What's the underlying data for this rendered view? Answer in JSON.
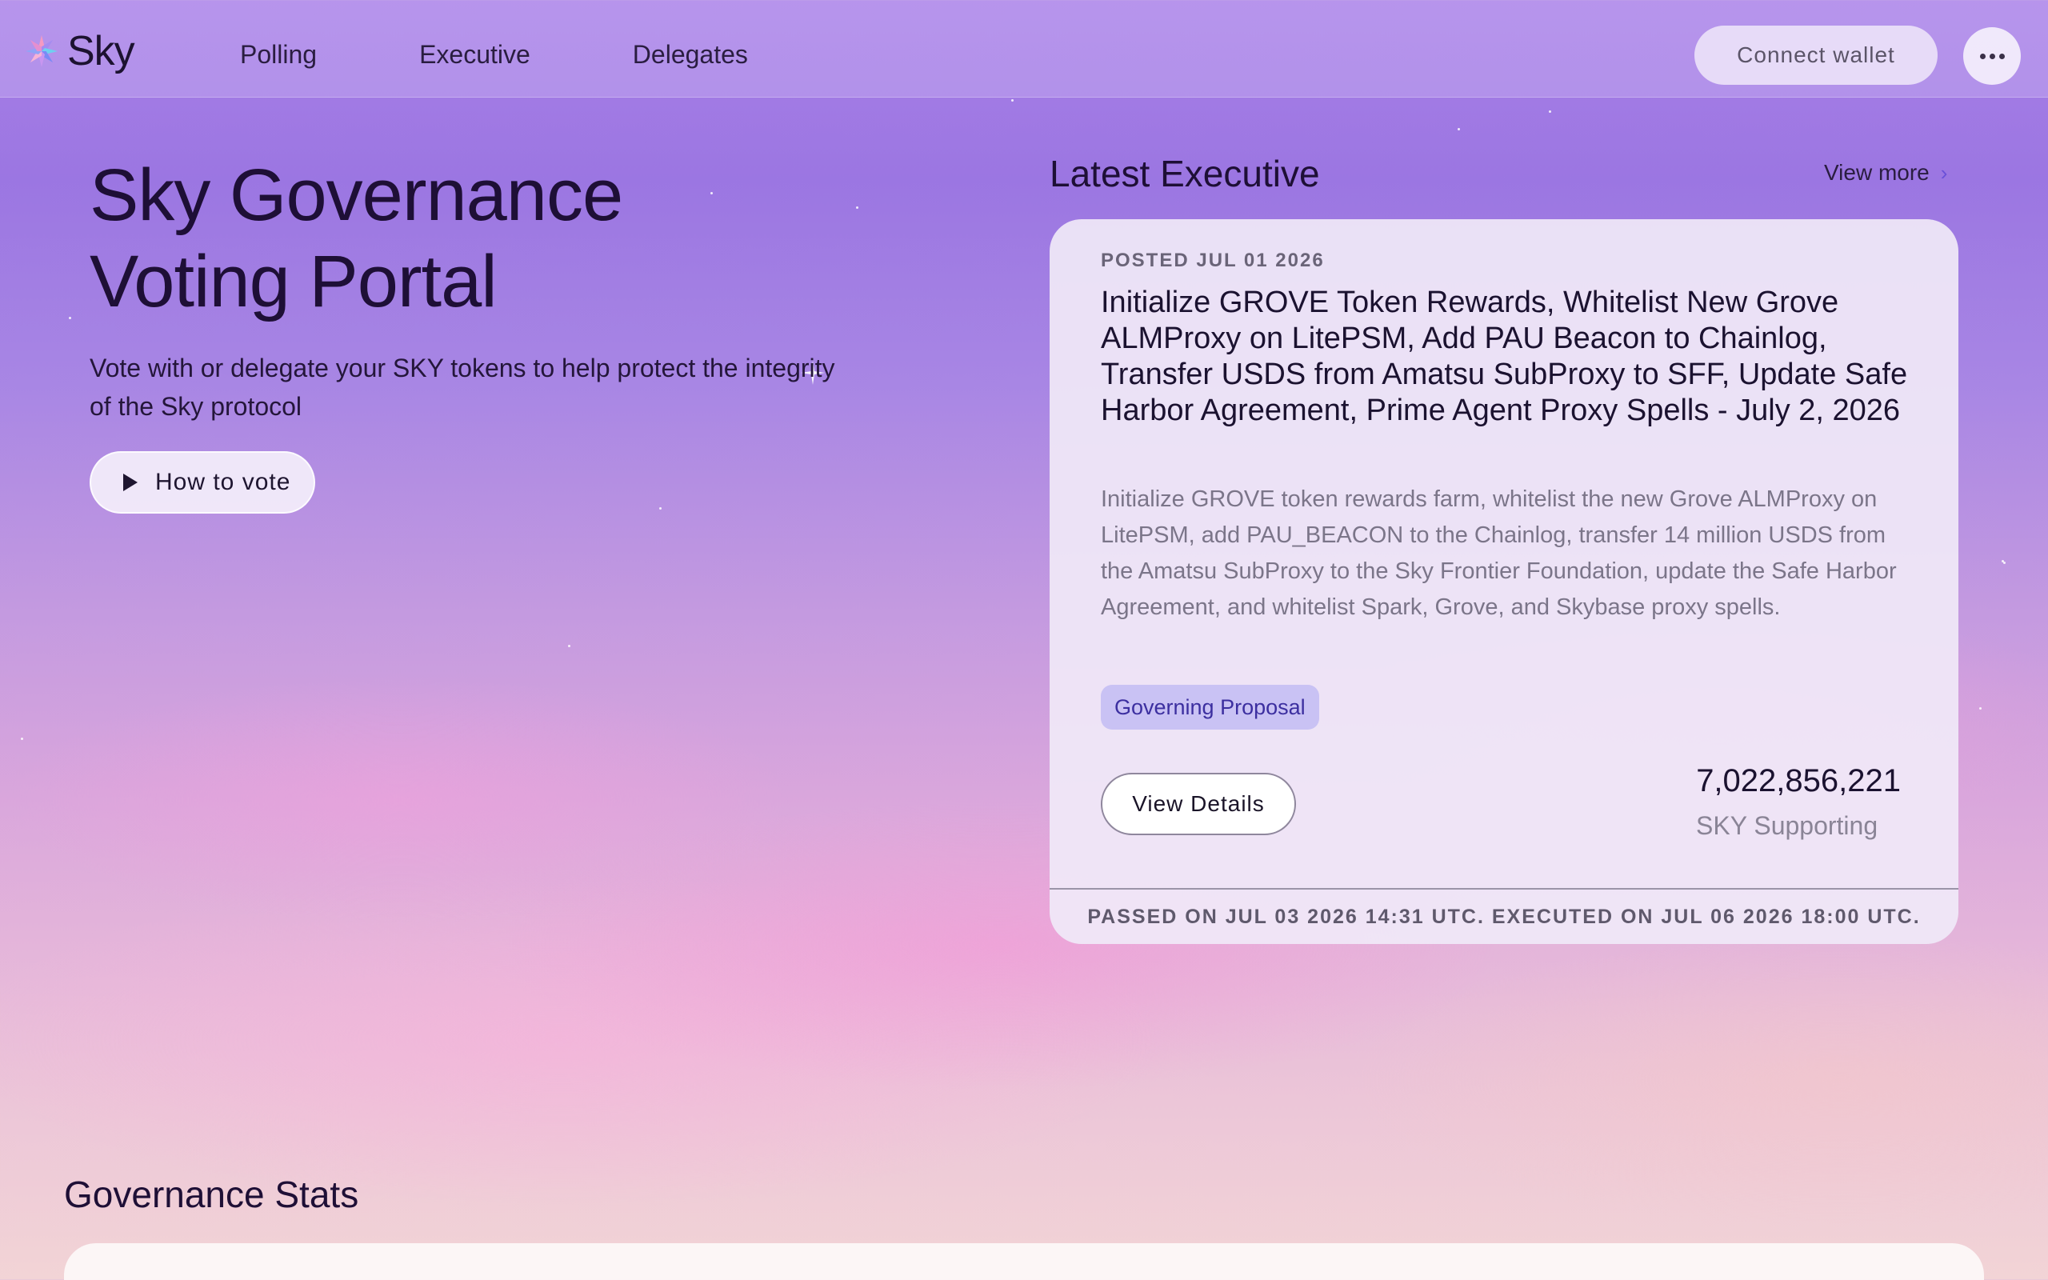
{
  "brand": {
    "name": "Sky"
  },
  "nav": {
    "items": [
      "Polling",
      "Executive",
      "Delegates"
    ]
  },
  "header": {
    "connect_label": "Connect wallet",
    "more_icon": "ellipsis-icon"
  },
  "hero": {
    "title": "Sky Governance Voting Portal",
    "subtitle": "Vote with or delegate your SKY tokens to help protect the integrity of the Sky protocol",
    "how_to_vote_label": "How to vote"
  },
  "latest_executive": {
    "heading": "Latest Executive",
    "view_more_label": "View more",
    "card": {
      "posted": "POSTED JUL 01 2026",
      "title": "Initialize GROVE Token Rewards, Whitelist New Grove ALMProxy on LitePSM, Add PAU Beacon to Chainlog, Transfer USDS from Amatsu SubProxy to SFF, Update Safe Harbor Agreement, Prime Agent Proxy Spells - July 2, 2026",
      "description": "Initialize GROVE token rewards farm, whitelist the new Grove ALMProxy on LitePSM, add PAU_BEACON to the Chainlog, transfer 14 million USDS from the Amatsu SubProxy to the Sky Frontier Foundation, update the Safe Harbor Agreement, and whitelist Spark, Grove, and Skybase proxy spells.",
      "tag": "Governing Proposal",
      "details_label": "View Details",
      "supporting_amount": "7,022,856,221",
      "supporting_label": "SKY Supporting",
      "footer": "PASSED ON JUL 03 2026 14:31 UTC. EXECUTED ON JUL 06 2026 18:00 UTC."
    }
  },
  "stats": {
    "heading": "Governance Stats"
  },
  "colors": {
    "accent": "#6a50d8",
    "tag_bg": "#c9c2f4",
    "tag_text": "#3c2fa0"
  }
}
